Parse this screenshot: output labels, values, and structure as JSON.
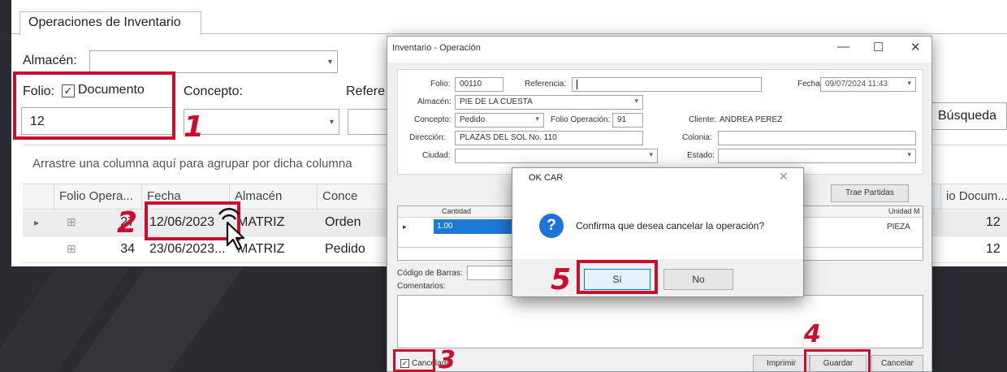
{
  "main": {
    "tab_label": "Operaciones de Inventario",
    "almacen_label": "Almacén:",
    "folio_label": "Folio:",
    "documento_label": "Documento",
    "documento_checked": true,
    "folio_value": "12",
    "concepto_label": "Concepto:",
    "referencia_label_partial": "Refere",
    "busqueda_button": "Búsqueda",
    "group_hint": "Arrastre una columna aquí para agrupar por dicha columna",
    "columns": [
      "Folio Opera...",
      "Fecha",
      "Almacén",
      "Conce",
      "io Docum..."
    ],
    "rows": [
      {
        "folio": "27",
        "fecha": "12/06/2023",
        "almacen": "MATRIZ",
        "concepto": "Orden",
        "doc": "12"
      },
      {
        "folio": "34",
        "fecha": "23/06/2023...",
        "almacen": "MATRIZ",
        "concepto": "Pedido",
        "doc": "12"
      }
    ]
  },
  "steps": {
    "s1": "1",
    "s2": "2",
    "s3": "3",
    "s4": "4",
    "s5": "5"
  },
  "dialog": {
    "title": "Inventario - Operación",
    "minimize_glyph": "—",
    "maximize_glyph": "☐",
    "close_glyph": "✕",
    "folio_label": "Folio:",
    "folio_value": "00110",
    "referencia_label": "Referencia:",
    "referencia_value": "",
    "fecha_label": "Fecha:",
    "fecha_value": "09/07/2024 11:43",
    "almacen_label": "Almacén:",
    "almacen_value": "PIE DE LA CUESTA",
    "concepto_label": "Concepto:",
    "concepto_value": "Pedido",
    "folio_operacion_label": "Folio Operación:",
    "folio_operacion_value": "91",
    "cliente_label": "Cliente:",
    "cliente_value": "ANDREA PEREZ",
    "direccion_label": "Dirección:",
    "direccion_value": "PLAZAS DEL SOL No. 110",
    "colonia_label": "Colonia:",
    "colonia_value": "",
    "ciudad_label": "Ciudad:",
    "ciudad_value": "",
    "estado_label": "Estado:",
    "estado_value": "",
    "trae_partidas_button": "Trae Partidas",
    "grid_columns": [
      "Cantidad",
      "Unidad M"
    ],
    "grid_row": {
      "cantidad": "1.00",
      "unidad": "PIEZA"
    },
    "codigo_barras_label": "Código de Barras:",
    "comentarios_label": "Comentarios:",
    "cancelada_label": "Cancelada",
    "cancelada_checked": true,
    "imprimir_button": "Imprimir",
    "guardar_button": "Guardar",
    "cancelar_button": "Cancelar"
  },
  "confirm": {
    "title": "OK CAR",
    "close_glyph": "✕",
    "message": "Confirma que desea cancelar la operación?",
    "icon_glyph": "?",
    "yes_button": "Sí",
    "no_button": "No"
  },
  "icons": {
    "checkmark": "✓",
    "dropdown": "▾",
    "row_pointer": "▸",
    "expand": "⊞"
  },
  "colors": {
    "highlight_red": "#c8102e",
    "selection_blue": "#1c7ad4",
    "question_blue": "#1e73d8"
  }
}
